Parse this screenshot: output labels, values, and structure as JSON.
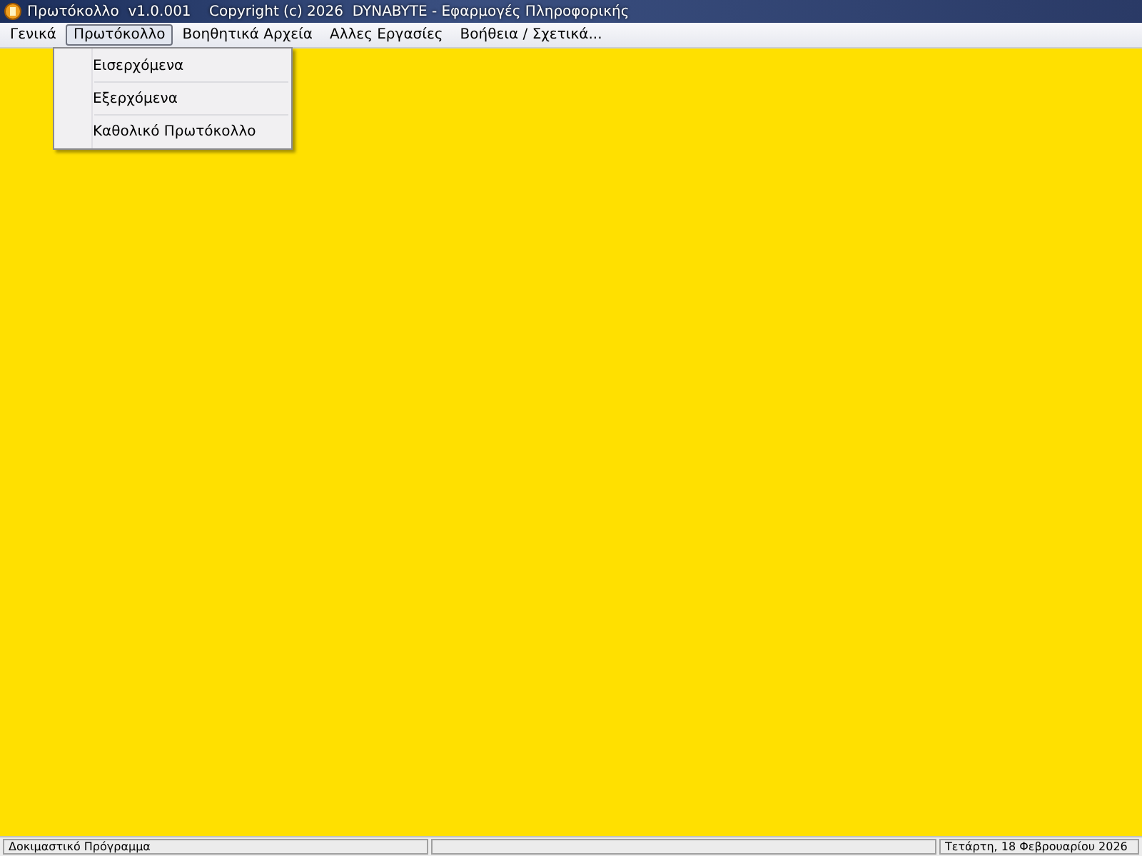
{
  "window": {
    "title": "Πρωτόκολλο  v1.0.001    Copyright (c) 2026  DYNABYTE - Εφαρμογές Πληροφορικής"
  },
  "menu_bar": [
    {
      "label": "Γενικά",
      "selected": false
    },
    {
      "label": "Πρωτόκολλο",
      "selected": true
    },
    {
      "label": "Βοηθητικά Αρχεία",
      "selected": false
    },
    {
      "label": "Αλλες Εργασίες",
      "selected": false
    },
    {
      "label": "Βοήθεια / Σχετικά...",
      "selected": false
    }
  ],
  "dropdown": {
    "items": [
      {
        "label": "Εισερχόμενα"
      },
      {
        "label": "Εξερχόμενα"
      },
      {
        "label": "Καθολικό Πρωτόκολλο"
      }
    ]
  },
  "status_bar": {
    "left": "Δοκιμαστικό Πρόγραμμα",
    "right": "Τετάρτη, 18 Φεβρουαρίου 2026"
  }
}
